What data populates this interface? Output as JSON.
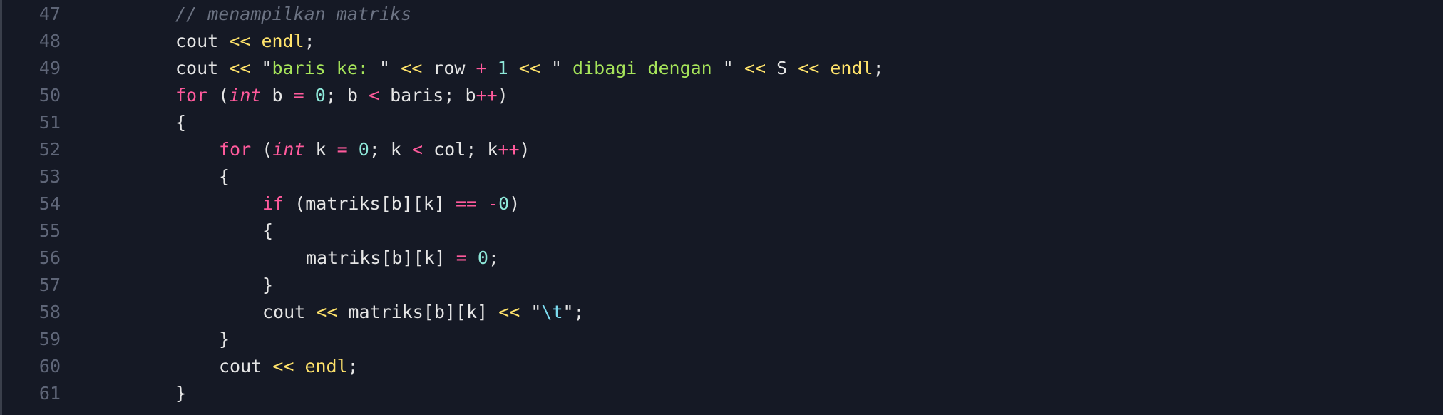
{
  "editor": {
    "language": "cpp",
    "colors": {
      "background": "#151925",
      "line_number": "#5f6678",
      "keyword": "#ff5a9c",
      "string": "#a6e45a",
      "number": "#8ee8d9",
      "stream_operator": "#ffe36b",
      "comment": "#6c7383",
      "text": "#e6e6e6"
    },
    "lines": [
      {
        "number": "47",
        "indent": 2,
        "tokens": [
          [
            "cmt",
            "// menampilkan matriks"
          ]
        ]
      },
      {
        "number": "48",
        "indent": 2,
        "tokens": [
          [
            "plain",
            "cout "
          ],
          [
            "ins",
            "<<"
          ],
          [
            "plain",
            " "
          ],
          [
            "ins",
            "endl"
          ],
          [
            "plain",
            ";"
          ]
        ]
      },
      {
        "number": "49",
        "indent": 2,
        "tokens": [
          [
            "plain",
            "cout "
          ],
          [
            "ins",
            "<<"
          ],
          [
            "plain",
            " "
          ],
          [
            "plain",
            "\""
          ],
          [
            "str",
            "baris ke: "
          ],
          [
            "plain",
            "\""
          ],
          [
            "plain",
            " "
          ],
          [
            "ins",
            "<<"
          ],
          [
            "plain",
            " row "
          ],
          [
            "op",
            "+"
          ],
          [
            "plain",
            " "
          ],
          [
            "num",
            "1"
          ],
          [
            "plain",
            " "
          ],
          [
            "ins",
            "<<"
          ],
          [
            "plain",
            " "
          ],
          [
            "plain",
            "\""
          ],
          [
            "str",
            " dibagi dengan "
          ],
          [
            "plain",
            "\""
          ],
          [
            "plain",
            " "
          ],
          [
            "ins",
            "<<"
          ],
          [
            "plain",
            " S "
          ],
          [
            "ins",
            "<<"
          ],
          [
            "plain",
            " "
          ],
          [
            "ins",
            "endl"
          ],
          [
            "plain",
            ";"
          ]
        ]
      },
      {
        "number": "50",
        "indent": 2,
        "tokens": [
          [
            "kw",
            "for"
          ],
          [
            "plain",
            " ("
          ],
          [
            "ty",
            "int"
          ],
          [
            "plain",
            " b "
          ],
          [
            "op",
            "="
          ],
          [
            "plain",
            " "
          ],
          [
            "num",
            "0"
          ],
          [
            "plain",
            "; b "
          ],
          [
            "op",
            "<"
          ],
          [
            "plain",
            " baris; b"
          ],
          [
            "op",
            "++"
          ],
          [
            "plain",
            ")"
          ]
        ]
      },
      {
        "number": "51",
        "indent": 2,
        "tokens": [
          [
            "plain",
            "{"
          ]
        ]
      },
      {
        "number": "52",
        "indent": 3,
        "tokens": [
          [
            "kw",
            "for"
          ],
          [
            "plain",
            " ("
          ],
          [
            "ty",
            "int"
          ],
          [
            "plain",
            " k "
          ],
          [
            "op",
            "="
          ],
          [
            "plain",
            " "
          ],
          [
            "num",
            "0"
          ],
          [
            "plain",
            "; k "
          ],
          [
            "op",
            "<"
          ],
          [
            "plain",
            " col; k"
          ],
          [
            "op",
            "++"
          ],
          [
            "plain",
            ")"
          ]
        ]
      },
      {
        "number": "53",
        "indent": 3,
        "tokens": [
          [
            "plain",
            "{"
          ]
        ]
      },
      {
        "number": "54",
        "indent": 4,
        "tokens": [
          [
            "kw",
            "if"
          ],
          [
            "plain",
            " (matriks[b][k] "
          ],
          [
            "op",
            "=="
          ],
          [
            "plain",
            " "
          ],
          [
            "op",
            "-"
          ],
          [
            "num",
            "0"
          ],
          [
            "plain",
            ")"
          ]
        ]
      },
      {
        "number": "55",
        "indent": 4,
        "tokens": [
          [
            "plain",
            "{"
          ]
        ]
      },
      {
        "number": "56",
        "indent": 5,
        "tokens": [
          [
            "plain",
            "matriks[b][k] "
          ],
          [
            "op",
            "="
          ],
          [
            "plain",
            " "
          ],
          [
            "num",
            "0"
          ],
          [
            "plain",
            ";"
          ]
        ]
      },
      {
        "number": "57",
        "indent": 4,
        "tokens": [
          [
            "plain",
            "}"
          ]
        ]
      },
      {
        "number": "58",
        "indent": 4,
        "tokens": [
          [
            "plain",
            "cout "
          ],
          [
            "ins",
            "<<"
          ],
          [
            "plain",
            " matriks[b][k] "
          ],
          [
            "ins",
            "<<"
          ],
          [
            "plain",
            " "
          ],
          [
            "plain",
            "\""
          ],
          [
            "esc",
            "\\t"
          ],
          [
            "plain",
            "\""
          ],
          [
            "plain",
            ";"
          ]
        ]
      },
      {
        "number": "59",
        "indent": 3,
        "tokens": [
          [
            "plain",
            "}"
          ]
        ]
      },
      {
        "number": "60",
        "indent": 3,
        "tokens": [
          [
            "plain",
            "cout "
          ],
          [
            "ins",
            "<<"
          ],
          [
            "plain",
            " "
          ],
          [
            "ins",
            "endl"
          ],
          [
            "plain",
            ";"
          ]
        ]
      },
      {
        "number": "61",
        "indent": 2,
        "tokens": [
          [
            "plain",
            "}"
          ]
        ]
      }
    ]
  }
}
